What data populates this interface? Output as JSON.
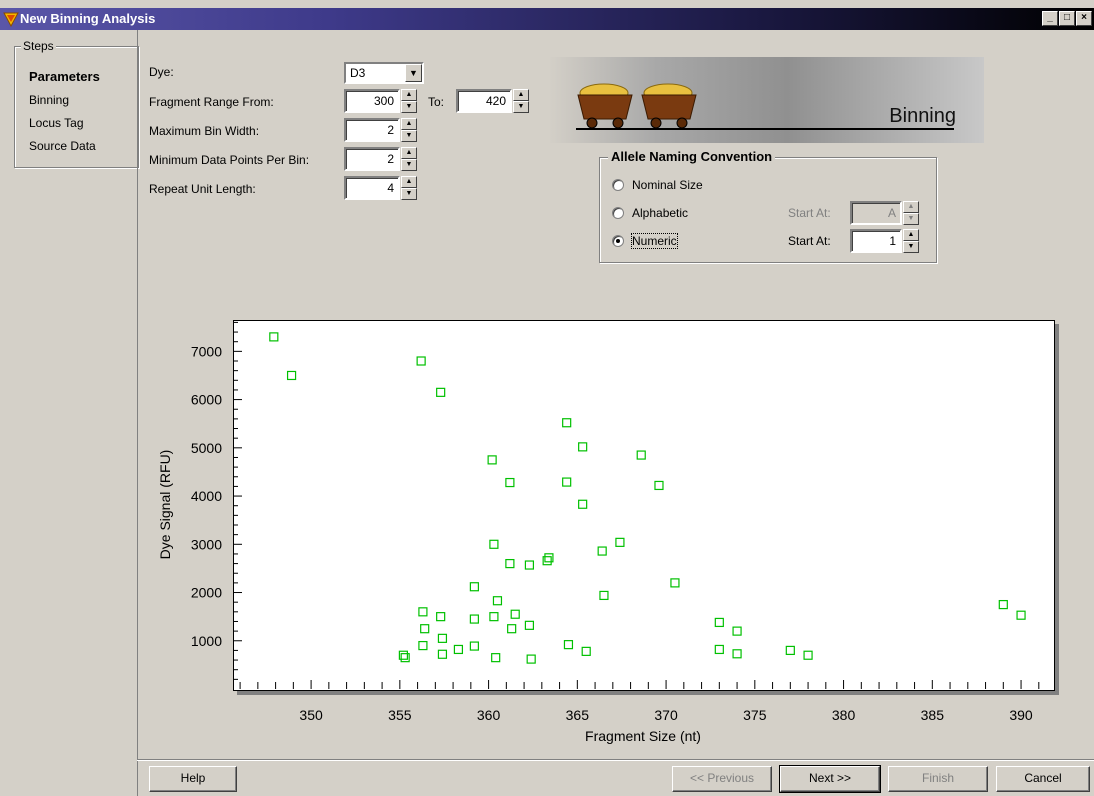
{
  "window": {
    "title": "New Binning Analysis"
  },
  "steps": {
    "legend": "Steps",
    "items": [
      {
        "label": "Parameters",
        "active": true
      },
      {
        "label": "Binning",
        "active": false
      },
      {
        "label": "Locus Tag",
        "active": false
      },
      {
        "label": "Source Data",
        "active": false
      }
    ]
  },
  "params": {
    "dye_label": "Dye:",
    "dye_value": "D3",
    "range_from_label": "Fragment Range From:",
    "range_from_value": "300",
    "range_to_label": "To:",
    "range_to_value": "420",
    "max_bin_width_label": "Maximum Bin Width:",
    "max_bin_width_value": "2",
    "min_points_label": "Minimum Data Points Per Bin:",
    "min_points_value": "2",
    "repeat_unit_label": "Repeat Unit Length:",
    "repeat_unit_value": "4"
  },
  "banner": {
    "word": "Binning"
  },
  "allele": {
    "legend": "Allele Naming Convention",
    "options": [
      {
        "label": "Nominal Size",
        "selected": false
      },
      {
        "label": "Alphabetic",
        "selected": false
      },
      {
        "label": "Numeric",
        "selected": true
      }
    ],
    "alpha_start_label": "Start At:",
    "alpha_start_value": "A",
    "num_start_label": "Start At:",
    "num_start_value": "1"
  },
  "chart_data": {
    "type": "scatter",
    "xlabel": "Fragment Size (nt)",
    "ylabel": "Dye Signal (RFU)",
    "xlim": [
      345.6,
      391.8
    ],
    "ylim": [
      0,
      7650
    ],
    "xticks": [
      350,
      355,
      360,
      365,
      370,
      375,
      380,
      385,
      390
    ],
    "yticks": [
      1000,
      2000,
      3000,
      4000,
      5000,
      6000,
      7000
    ],
    "marker_color": "#00c000",
    "points": [
      [
        347.9,
        7300
      ],
      [
        348.9,
        6500
      ],
      [
        355.2,
        700
      ],
      [
        355.3,
        650
      ],
      [
        356.2,
        6800
      ],
      [
        356.3,
        1600
      ],
      [
        356.4,
        1250
      ],
      [
        356.3,
        900
      ],
      [
        357.3,
        6150
      ],
      [
        357.3,
        1500
      ],
      [
        357.4,
        1050
      ],
      [
        357.4,
        720
      ],
      [
        358.3,
        820
      ],
      [
        359.2,
        2120
      ],
      [
        359.2,
        1450
      ],
      [
        359.2,
        890
      ],
      [
        360.2,
        4750
      ],
      [
        360.3,
        3000
      ],
      [
        360.3,
        1500
      ],
      [
        360.4,
        650
      ],
      [
        360.5,
        1830
      ],
      [
        361.2,
        4280
      ],
      [
        361.2,
        2600
      ],
      [
        361.3,
        1250
      ],
      [
        361.5,
        1550
      ],
      [
        362.3,
        2570
      ],
      [
        362.3,
        1320
      ],
      [
        362.4,
        620
      ],
      [
        363.3,
        2660
      ],
      [
        363.4,
        2720
      ],
      [
        364.4,
        5520
      ],
      [
        364.4,
        4290
      ],
      [
        364.5,
        920
      ],
      [
        365.3,
        5020
      ],
      [
        365.3,
        3830
      ],
      [
        365.5,
        780
      ],
      [
        366.4,
        2860
      ],
      [
        366.5,
        1940
      ],
      [
        367.4,
        3040
      ],
      [
        368.6,
        4850
      ],
      [
        369.6,
        4220
      ],
      [
        370.5,
        2200
      ],
      [
        373.0,
        1380
      ],
      [
        373.0,
        820
      ],
      [
        374.0,
        1200
      ],
      [
        374.0,
        730
      ],
      [
        377.0,
        800
      ],
      [
        378.0,
        700
      ],
      [
        389.0,
        1750
      ],
      [
        390.0,
        1530
      ]
    ]
  },
  "buttons": {
    "help": "Help",
    "previous": "<< Previous",
    "next": "Next >>",
    "finish": "Finish",
    "cancel": "Cancel"
  }
}
